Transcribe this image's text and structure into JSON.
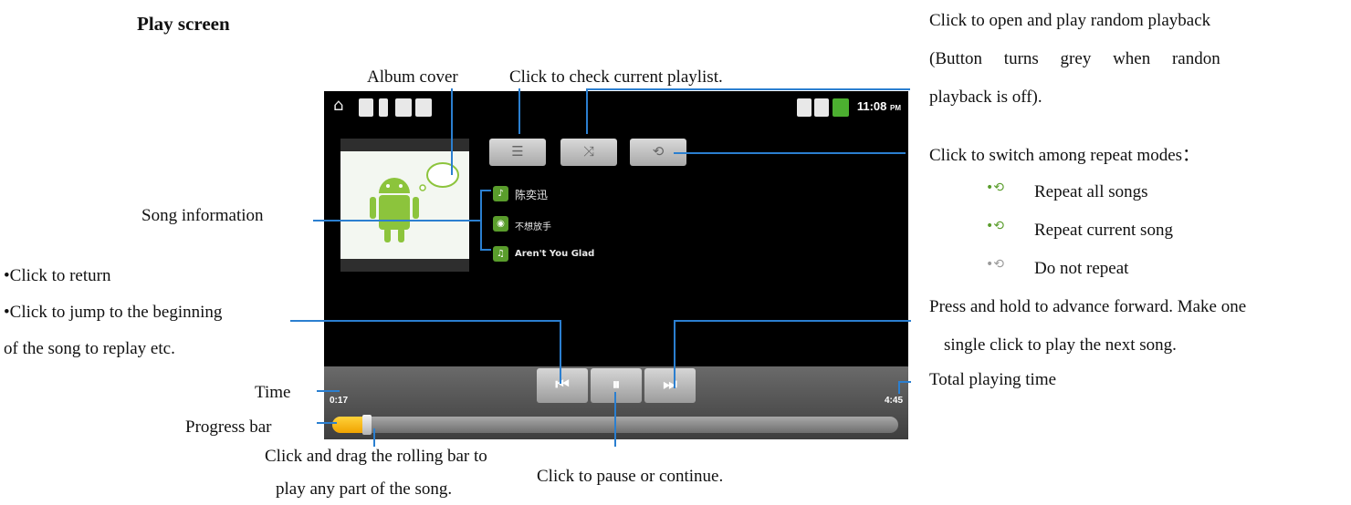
{
  "heading": "Play screen",
  "labels": {
    "album_cover": "Album cover",
    "check_playlist": "Click to check current playlist.",
    "song_info": "Song  information",
    "click_return": "•Click to return",
    "jump_begin_1": "•Click  to  jump  to  the  beginning",
    "jump_begin_2": "of the song to replay etc.",
    "time": "Time",
    "progress_bar": "Progress bar",
    "drag_1": "Click  and  drag  the  rolling  bar  to",
    "drag_2": "play any part of the song.",
    "pause_continue": "Click to pause or continue.",
    "random_1": "Click to open and play random playback",
    "random_2": "(Button     turns     grey     when     randon",
    "random_3": "playback is off).",
    "repeat_switch": "Click to switch among repeat modes：",
    "repeat_all": "Repeat all songs",
    "repeat_current": "Repeat current song",
    "no_repeat": "Do not repeat",
    "advance_1": "Press and hold to advance forward. Make one",
    "advance_2": "single click to play the next song.",
    "total_time": "Total playing time"
  },
  "phone": {
    "clock": "11:08",
    "clock_ampm": "PM",
    "artist": "陈奕迅",
    "album": "不想放手",
    "song": "Aren't You Glad",
    "elapsed": "0:17",
    "duration": "4:45",
    "progress_fraction": 0.06,
    "btn_playlist": "☰",
    "btn_shuffle": "⤨",
    "btn_repeat": "⟲",
    "btn_prev": "⏮",
    "btn_pause": "⏸",
    "btn_next": "⏭"
  },
  "colors": {
    "accent": "#5a9d2c",
    "progress": "#f5b400",
    "leader_line": "#2b7fd0"
  }
}
